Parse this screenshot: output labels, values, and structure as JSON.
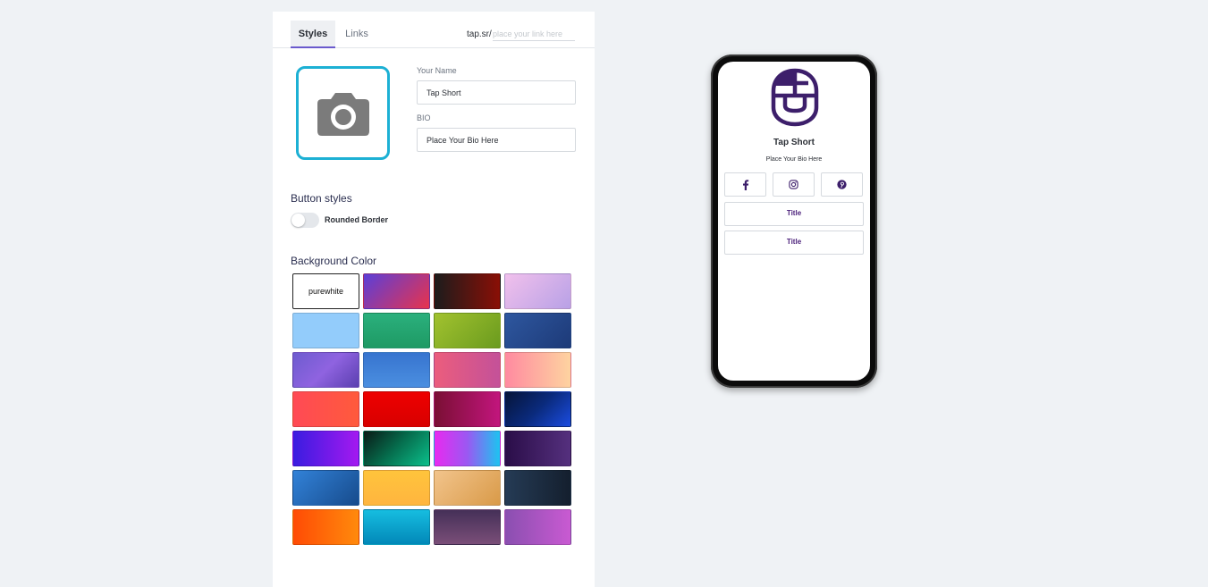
{
  "tabs": [
    {
      "label": "Styles",
      "active": true
    },
    {
      "label": "Links",
      "active": false
    }
  ],
  "url": {
    "prefix": "tap.sr/",
    "placeholder": "place your link here"
  },
  "profile": {
    "photo_icon": "camera-icon",
    "name_label": "Your Name",
    "name_value": "Tap Short",
    "bio_label": "BIO",
    "bio_value": "Place Your Bio Here"
  },
  "button_styles": {
    "title": "Button styles",
    "toggle_label": "Rounded Border",
    "toggle_on": false
  },
  "background": {
    "title": "Background Color",
    "selected": "purewhite",
    "swatches": [
      {
        "label": "purewhite",
        "bg": "#ffffff"
      },
      {
        "bg": "linear-gradient(135deg,#5b3fd8,#e8334c)"
      },
      {
        "bg": "linear-gradient(90deg,#1c1c1c,#8a0f06)"
      },
      {
        "bg": "linear-gradient(135deg,#f1c0ec,#b8a1e6)"
      },
      {
        "bg": "#93ccfb"
      },
      {
        "bg": "linear-gradient(180deg,#2bb07d,#1e9a64)"
      },
      {
        "bg": "linear-gradient(135deg,#a2c22f,#6a9b1e)"
      },
      {
        "bg": "linear-gradient(135deg,#2e579f,#1d3a78)"
      },
      {
        "bg": "linear-gradient(135deg,#6d5ccf,#8f63e0,#5b3fb0)"
      },
      {
        "bg": "linear-gradient(180deg,#3774cf,#4b8fe0)"
      },
      {
        "bg": "linear-gradient(90deg,#eb5d7d,#c45199)"
      },
      {
        "bg": "linear-gradient(90deg,#ff8aa0,#fed3a0)"
      },
      {
        "bg": "linear-gradient(90deg,#ff4a55,#ff5a3c)"
      },
      {
        "bg": "linear-gradient(180deg,#ee0000,#d80000)"
      },
      {
        "bg": "linear-gradient(90deg,#7a0f34,#c2157d)"
      },
      {
        "bg": "linear-gradient(135deg,#061438,#0a2a7c,#1b4ce0)"
      },
      {
        "bg": "linear-gradient(90deg,#3a1ce0,#a419f0)"
      },
      {
        "bg": "linear-gradient(135deg,#0a1a16,#06704f,#0bc08c)"
      },
      {
        "bg": "linear-gradient(90deg,#e82af0,#9b58f2,#1cc4f0)"
      },
      {
        "bg": "linear-gradient(90deg,#2a0d48,#55307e)"
      },
      {
        "bg": "linear-gradient(135deg,#3282d8,#174b8c)"
      },
      {
        "bg": "linear-gradient(180deg,#ffc43c,#ffb53f)"
      },
      {
        "bg": "linear-gradient(135deg,#f2c48c,#d99a48)"
      },
      {
        "bg": "linear-gradient(90deg,#253b55,#141f2e)"
      },
      {
        "bg": "linear-gradient(90deg,#ff4b05,#ff8a0c)"
      },
      {
        "bg": "linear-gradient(180deg,#16bde0,#0288b8)"
      },
      {
        "bg": "linear-gradient(180deg,#453058,#7a4e78)"
      },
      {
        "bg": "linear-gradient(90deg,#8a4fb0,#c95ad2)"
      }
    ]
  },
  "preview": {
    "logo_icon": "tap-short-logo",
    "name": "Tap Short",
    "bio": "Place Your Bio Here",
    "socials": [
      "facebook-icon",
      "instagram-icon",
      "pinterest-icon"
    ],
    "links": [
      "Title",
      "Title"
    ],
    "accent": "#3d1f6b"
  }
}
